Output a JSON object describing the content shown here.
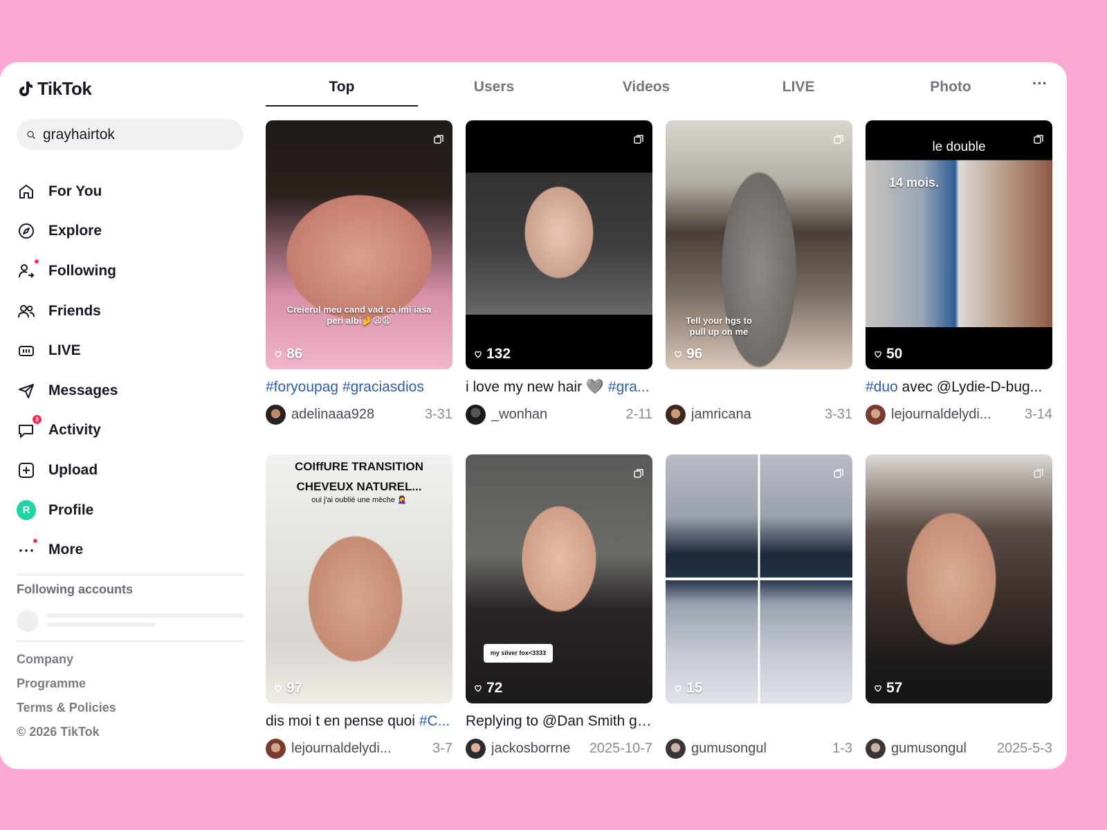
{
  "app": {
    "name": "TikTok"
  },
  "search": {
    "value": "grayhairtok"
  },
  "nav": [
    {
      "label": "For You",
      "icon": "home-icon"
    },
    {
      "label": "Explore",
      "icon": "compass-icon"
    },
    {
      "label": "Following",
      "icon": "following-icon"
    },
    {
      "label": "Friends",
      "icon": "friends-icon"
    },
    {
      "label": "LIVE",
      "icon": "live-icon"
    },
    {
      "label": "Messages",
      "icon": "send-icon"
    },
    {
      "label": "Activity",
      "icon": "activity-icon",
      "badge": "3"
    },
    {
      "label": "Upload",
      "icon": "upload-icon"
    },
    {
      "label": "Profile",
      "avatar_letter": "R"
    },
    {
      "label": "More",
      "icon": "more-icon"
    }
  ],
  "following_accounts_title": "Following accounts",
  "footer": [
    "Company",
    "Programme",
    "Terms & Policies",
    "© 2026 TikTok"
  ],
  "tabs": [
    "Top",
    "Users",
    "Videos",
    "LIVE",
    "Photo"
  ],
  "tabs_more": "···",
  "colors": {
    "accent": "#fe2c55",
    "hashtag": "#2b5db9",
    "background": "#fda7d5",
    "profile_avatar": "#20d5a4"
  },
  "videos": [
    {
      "likes": "86",
      "caption_tags": "#foryoupag #graciasdios",
      "caption_text": "",
      "author": "adelinaaa928",
      "date": "3-31",
      "overlay": "Creierul meu cand vad ca  imi iasa peri albi🤌😩😩"
    },
    {
      "likes": "132",
      "caption_text": "i love my new hair 🩶  ",
      "caption_tags": "#gra...",
      "author": "_wonhan",
      "date": "2-11"
    },
    {
      "likes": "96",
      "caption_text": "",
      "caption_tags": "",
      "author": "jamricana",
      "date": "3-31",
      "overlay": "Tell your hgs to pull up on me"
    },
    {
      "likes": "50",
      "caption_tags": "#duo",
      "caption_text": " avec @Lydie-D-bug...",
      "author": "lejournaldelydi...",
      "date": "3-14",
      "overlay_title": "le double",
      "overlay_sub": "14 mois."
    },
    {
      "likes": "97",
      "caption_text": "dis moi t en pense quoi ",
      "caption_tags": "#C...",
      "author": "lejournaldelydi...",
      "date": "3-7",
      "overlay_title": "COIffURE TRANSITION CHEVEUX NATUREL...",
      "overlay_sub": "oui j'ai oublié une mèche 🤦‍♀️"
    },
    {
      "likes": "72",
      "caption_text": "Replying to @Dan Smith gr...",
      "caption_tags": "",
      "author": "jackosborrne",
      "date": "2025-10-7",
      "overlay": "my silver fox<3333"
    },
    {
      "likes": "15",
      "caption_text": "",
      "caption_tags": "",
      "author": "gumusongul",
      "date": "1-3"
    },
    {
      "likes": "57",
      "caption_text": "",
      "caption_tags": "",
      "author": "gumusongul",
      "date": "2025-5-3"
    }
  ]
}
